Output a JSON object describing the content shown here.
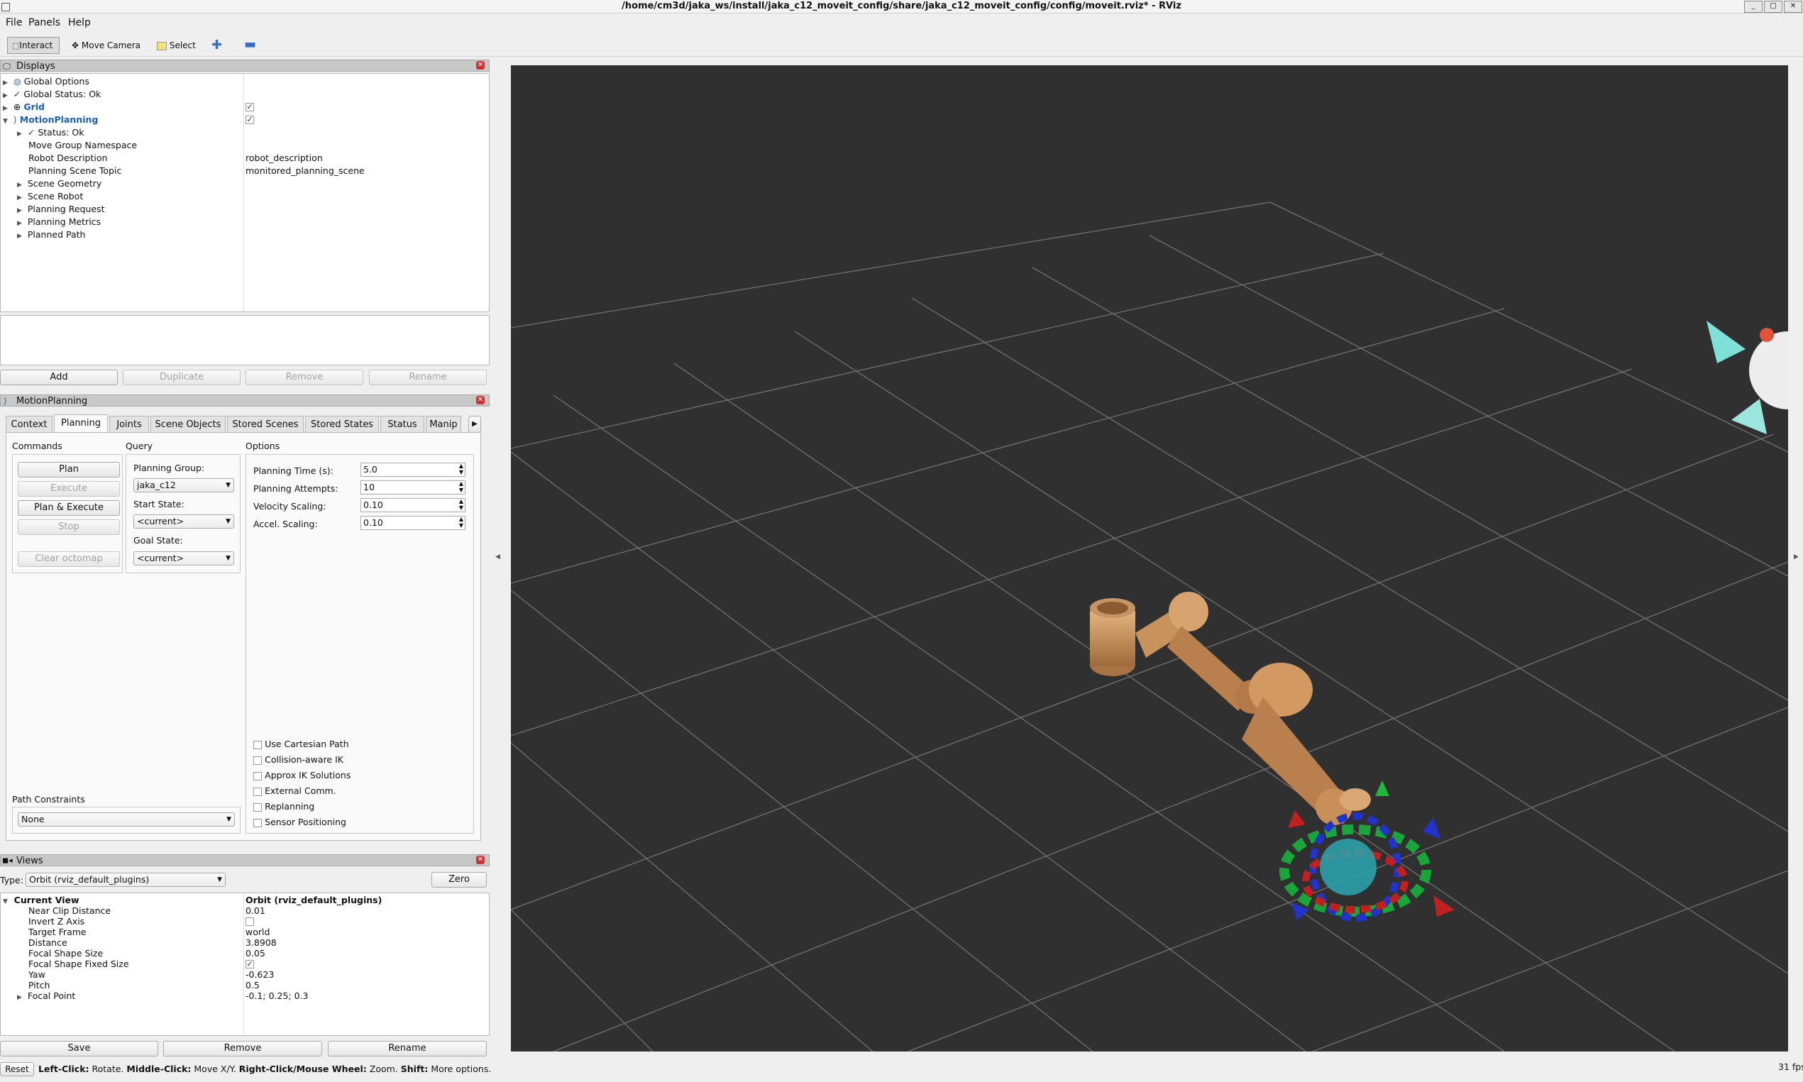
{
  "window": {
    "title": "/home/cm3d/jaka_ws/install/jaka_c12_moveit_config/share/jaka_c12_moveit_config/config/moveit.rviz* - RViz",
    "buttons": [
      "_",
      "□",
      "✕"
    ]
  },
  "menu": [
    "File",
    "Panels",
    "Help"
  ],
  "toolbar": {
    "interact": "Interact",
    "move_camera": "Move Camera",
    "select": "Select"
  },
  "displays": {
    "title": "Displays",
    "items": [
      {
        "label": "Global Options",
        "value": ""
      },
      {
        "label": "Global Status: Ok",
        "value": ""
      },
      {
        "label": "Grid",
        "value": "✓"
      },
      {
        "label": "MotionPlanning",
        "value": "✓"
      },
      {
        "label": "Status: Ok",
        "value": ""
      },
      {
        "label": "Move Group Namespace",
        "value": ""
      },
      {
        "label": "Robot Description",
        "value": "robot_description"
      },
      {
        "label": "Planning Scene Topic",
        "value": "monitored_planning_scene"
      },
      {
        "label": "Scene Geometry",
        "value": ""
      },
      {
        "label": "Scene Robot",
        "value": ""
      },
      {
        "label": "Planning Request",
        "value": ""
      },
      {
        "label": "Planning Metrics",
        "value": ""
      },
      {
        "label": "Planned Path",
        "value": ""
      }
    ],
    "buttons": {
      "add": "Add",
      "duplicate": "Duplicate",
      "remove": "Remove",
      "rename": "Rename"
    }
  },
  "motion_planning": {
    "title": "MotionPlanning",
    "tabs": [
      "Context",
      "Planning",
      "Joints",
      "Scene Objects",
      "Stored Scenes",
      "Stored States",
      "Status",
      "Manip"
    ],
    "commands": {
      "title": "Commands",
      "plan": "Plan",
      "execute": "Execute",
      "plan_execute": "Plan & Execute",
      "stop": "Stop",
      "clear_octomap": "Clear octomap"
    },
    "query": {
      "title": "Query",
      "planning_group_label": "Planning Group:",
      "planning_group": "jaka_c12",
      "start_state_label": "Start State:",
      "start_state": "<current>",
      "goal_state_label": "Goal State:",
      "goal_state": "<current>"
    },
    "options": {
      "title": "Options",
      "planning_time_label": "Planning Time (s):",
      "planning_time": "5.0",
      "planning_attempts_label": "Planning Attempts:",
      "planning_attempts": "10",
      "velocity_scaling_label": "Velocity Scaling:",
      "velocity_scaling": "0.10",
      "accel_scaling_label": "Accel. Scaling:",
      "accel_scaling": "0.10",
      "checkboxes": [
        "Use Cartesian Path",
        "Collision-aware IK",
        "Approx IK Solutions",
        "External Comm.",
        "Replanning",
        "Sensor Positioning"
      ]
    },
    "path_constraints": {
      "label": "Path Constraints",
      "value": "None"
    }
  },
  "views": {
    "title": "Views",
    "type_label": "Type:",
    "type": "Orbit (rviz_default_plugins)",
    "zero": "Zero",
    "current_view": "Current View",
    "current_view_value": "Orbit (rviz_default_plugins)",
    "props": [
      {
        "label": "Near Clip Distance",
        "value": "0.01"
      },
      {
        "label": "Invert Z Axis",
        "value": ""
      },
      {
        "label": "Target Frame",
        "value": "world"
      },
      {
        "label": "Distance",
        "value": "3.8908"
      },
      {
        "label": "Focal Shape Size",
        "value": "0.05"
      },
      {
        "label": "Focal Shape Fixed Size",
        "value": "✓"
      },
      {
        "label": "Yaw",
        "value": "-0.623"
      },
      {
        "label": "Pitch",
        "value": "0.5"
      },
      {
        "label": "Focal Point",
        "value": "-0.1; 0.25; 0.3"
      }
    ],
    "buttons": {
      "save": "Save",
      "remove": "Remove",
      "rename": "Rename"
    }
  },
  "status": {
    "reset": "Reset",
    "left_click": "Left-Click:",
    "left_action": " Rotate. ",
    "middle_click": "Middle-Click:",
    "middle_action": " Move X/Y. ",
    "right_click": "Right-Click/Mouse Wheel:",
    "right_action": " Zoom. ",
    "shift": "Shift:",
    "shift_action": " More options.",
    "fps": "31 fps"
  },
  "colors": {
    "viewport_bg": "#303030",
    "grid_line": "#9a9a9a",
    "robot": "#d29a62",
    "accent_link": "#1c5fb8"
  }
}
